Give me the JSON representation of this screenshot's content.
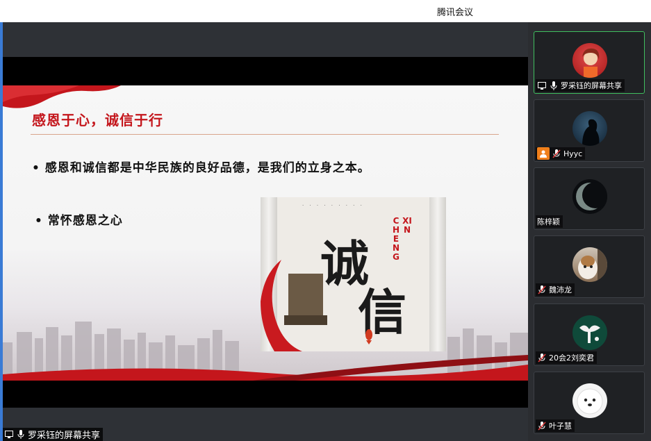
{
  "window": {
    "title": "腾讯会议"
  },
  "slide": {
    "title": "感恩于心，诚信于行",
    "bullets": [
      "• 感恩和诚信都是中华民族的良好品德，是我们的立身之本。",
      "•  常怀感恩之心"
    ],
    "poster": {
      "char1": "诚",
      "char2": "信",
      "pinyin1": "CHENG",
      "pinyin2": "XIN"
    }
  },
  "share_label": "罗采钰的屏幕共享",
  "participants": [
    {
      "name": "罗采钰的屏幕共享",
      "mic": "on",
      "sharing": true,
      "active": true
    },
    {
      "name": "Hyyc",
      "mic": "muted",
      "orange_badge": true
    },
    {
      "name": "陈梓颖",
      "mic": "none"
    },
    {
      "name": "魏沛龙",
      "mic": "muted"
    },
    {
      "name": "20会2刘奕君",
      "mic": "muted"
    },
    {
      "name": "叶子慧",
      "mic": "muted"
    }
  ],
  "colors": {
    "accent_green": "#3fbf5f",
    "slide_red": "#c4161c",
    "muted_red": "#e23d3d"
  }
}
